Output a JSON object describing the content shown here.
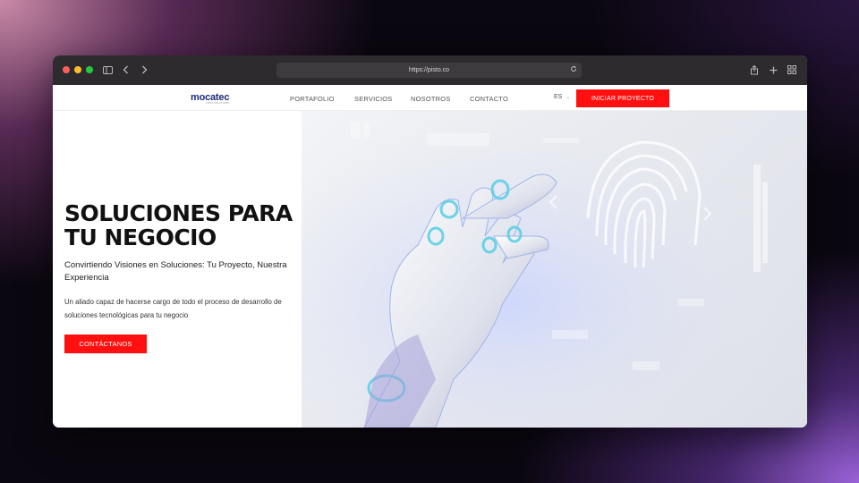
{
  "browser": {
    "url": "https://pisto.co"
  },
  "navbar": {
    "logo": "mocatec",
    "logo_sub": "TECH SOLUTIONS",
    "links": [
      "PORTAFOLIO",
      "SERVICIOS",
      "NOSOTROS",
      "CONTACTO"
    ],
    "language": "ES",
    "cta": "INICIAR PROYECTO"
  },
  "hero": {
    "title_line1": "SOLUCIONES PARA",
    "title_line2": "TU NEGOCIO",
    "subtitle": "Convirtiendo Visiones en Soluciones: Tu Proyecto, Nuestra Experiencia",
    "description": "Un aliado capaz de hacerse cargo de todo el proceso de desarrollo de soluciones tecnológicas para tu negocio",
    "button": "CONTÁCTANOS"
  },
  "colors": {
    "accent": "#ff1010",
    "logo": "#1f2a7a",
    "chrome": "#2d2b2e"
  }
}
